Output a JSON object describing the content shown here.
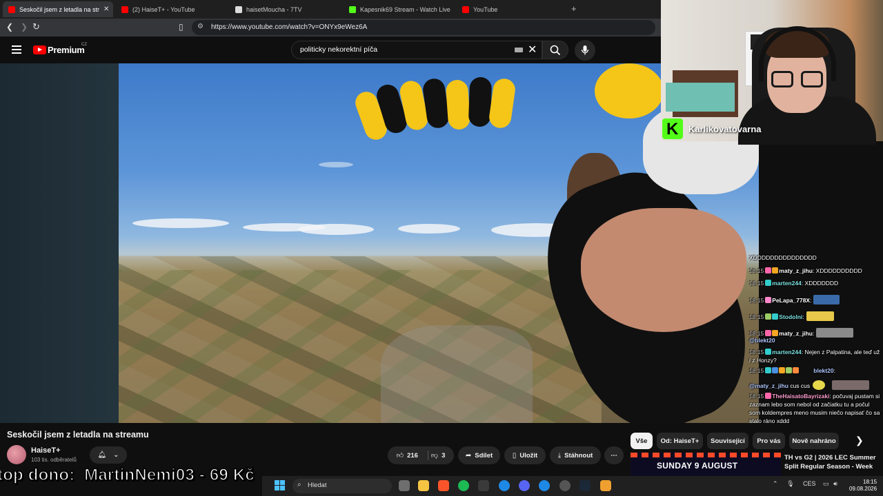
{
  "browser": {
    "tabs": [
      {
        "label": "Seskočil jsem z letadla na str",
        "color": "#ff0000"
      },
      {
        "label": "(2) HaiseT+ - YouTube",
        "color": "#ff0000"
      },
      {
        "label": "haisetMoucha - 7TV",
        "color": "#dddddd"
      },
      {
        "label": "Kapesnik69 Stream - Watch Live",
        "color": "#53fc18"
      },
      {
        "label": "YouTube",
        "color": "#ff0000"
      }
    ],
    "new_tab": "+",
    "url": "https://www.youtube.com/watch?v=ONYx9eWez6A"
  },
  "youtube": {
    "brand": "Premium",
    "country": "CZ",
    "search_query": "politicky nekorektní píča",
    "video_title": "Seskočil jsem z letadla na streamu",
    "channel_name": "HaiseT+",
    "subscribers": "103 tis. odběratelů",
    "likes": "216",
    "dislikes": "3",
    "share_label": "Sdílet",
    "save_label": "Uložit",
    "download_label": "Stáhnout",
    "more_label": "⋯",
    "chips": [
      "Vše",
      "Od: HaiseT+",
      "Související",
      "Pro vás",
      "Nově nahráno"
    ],
    "recommended": {
      "thumb_text": "SUNDAY 9 AUGUST",
      "title": "TH vs G2 | 2026 LEC Summer Split Regular Season - Week"
    }
  },
  "stream": {
    "webcam_name": "Karlikovatovarna",
    "dono": "top dono:  MartinNemi03 - 69 Kč",
    "chat": [
      {
        "ts": "",
        "user": "",
        "msg": "XDDDDDDDDDDDDDDD",
        "badge": ""
      },
      {
        "ts": "18:15",
        "user": "maty_z_jihu",
        "msg": ": XDDDDDDDDDD",
        "badge": "#ff66aa"
      },
      {
        "ts": "18:15",
        "user": "marten244",
        "msg": ": XDDDDDDD",
        "badge": "#33cccc"
      },
      {
        "ts": "18:15",
        "user": "PeLapa_778X",
        "msg": ":",
        "badge": "#ff88cc"
      },
      {
        "ts": "18:15",
        "user": "Stodolni",
        "msg": ":",
        "badge": "#33cccc"
      },
      {
        "ts": "18:15",
        "user": "maty_z_jihu",
        "msg": ":",
        "badge": "#ff66aa"
      },
      {
        "ts": "",
        "user": "@blekt20",
        "msg": "",
        "badge": ""
      },
      {
        "ts": "18:15",
        "user": "marten244",
        "msg": ": Nejen z Palpatina, ale teď už i z Honzy?",
        "badge": "#33cccc"
      },
      {
        "ts": "18:15",
        "user": "blekt20",
        "msg": ":",
        "badge": "#33cccc"
      },
      {
        "ts": "",
        "user": "@maty_z_jihu",
        "msg": " cus cus",
        "badge": ""
      },
      {
        "ts": "18:15",
        "user": "TheHaisatoBayrizaki",
        "msg": ": počuvaj pustam si zaznam lebo som nebol od začiatku tu a počul som koldempres meno musim niečo napisať čo sa stalo ráno xddd",
        "badge": "#ff66aa"
      }
    ]
  },
  "taskbar": {
    "search_placeholder": "Hledat",
    "language": "CES",
    "time": "18:15",
    "date": "09.08.2026"
  }
}
